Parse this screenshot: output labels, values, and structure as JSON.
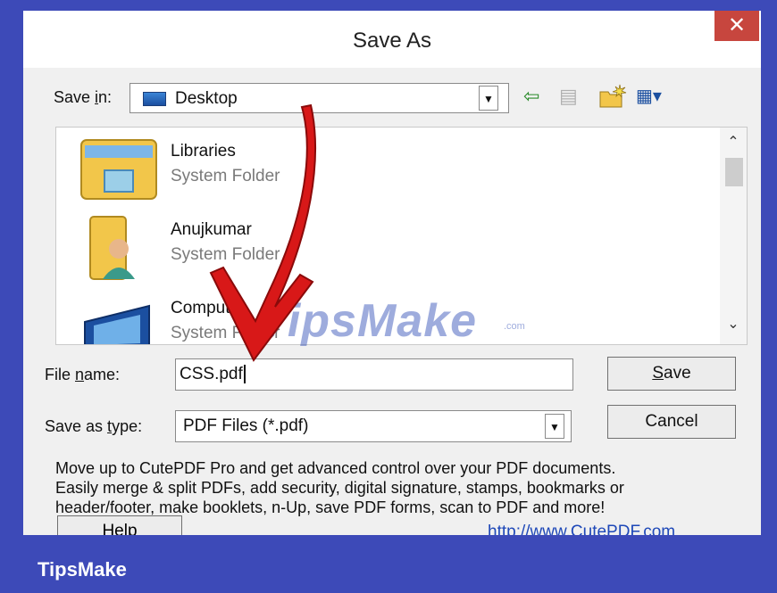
{
  "dialog": {
    "title": "Save As",
    "close_glyph": "✕"
  },
  "save_in": {
    "label_pre": "Save ",
    "label_accel": "i",
    "label_post": "n:",
    "value": "Desktop",
    "icon": "desktop-icon"
  },
  "toolbar": {
    "back_glyph": "⇦",
    "up_glyph": "▤",
    "new_folder_glyph": "✱",
    "view_glyph": "▦▾"
  },
  "file_list": {
    "items": [
      {
        "name": "Libraries",
        "type": "System Folder",
        "icon": "libraries-folder-icon"
      },
      {
        "name": "Anujkumar",
        "type": "System Folder",
        "icon": "user-folder-icon"
      },
      {
        "name": "Computer",
        "type": "System Folder",
        "icon": "computer-icon"
      }
    ]
  },
  "file_name": {
    "label_pre": "File ",
    "label_accel": "n",
    "label_post": "ame:",
    "value": "CSS.pdf"
  },
  "save_as_type": {
    "label_pre": "Save as ",
    "label_accel": "t",
    "label_post": "ype:",
    "value": "PDF Files (*.pdf)"
  },
  "buttons": {
    "save_accel": "S",
    "save_rest": "ave",
    "cancel": "Cancel",
    "help": "Help"
  },
  "promo": {
    "line1": "Move up to CutePDF Pro and get advanced control over your PDF documents.",
    "line2": "Easily merge & split PDFs, add security, digital signature, stamps, bookmarks or",
    "line3": "header/footer, make booklets, n-Up, save PDF forms, scan to PDF and more!",
    "link": "http://www.CutePDF.com"
  },
  "watermark": {
    "text": "TipsMake",
    "suffix": ".com"
  },
  "footer": {
    "brand": "TipsMake"
  },
  "colors": {
    "frame": "#3d4ab8",
    "close": "#c7463e",
    "arrow": "#d81818",
    "link": "#1e48b8"
  }
}
